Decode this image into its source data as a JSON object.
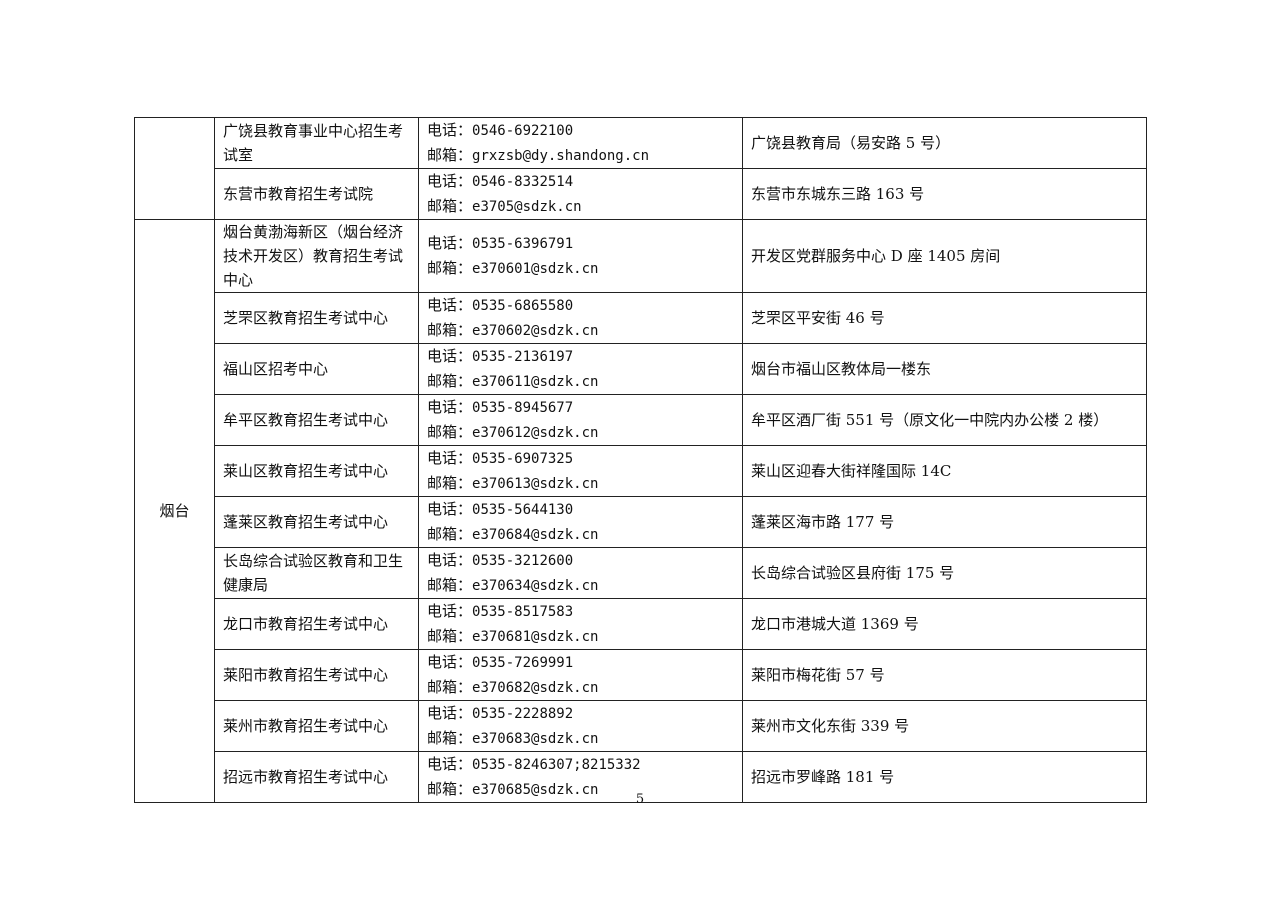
{
  "table": {
    "groups": [
      {
        "city": "",
        "rows": [
          {
            "org": "广饶县教育事业中心招生考试室",
            "phone_label": "电话：",
            "phone": "0546-6922100",
            "email_label": "邮箱：",
            "email": "grxzsb@dy.shandong.cn",
            "address": "广饶县教育局（易安路 5 号）"
          },
          {
            "org": "东营市教育招生考试院",
            "phone_label": "电话：",
            "phone": "0546-8332514",
            "email_label": "邮箱：",
            "email": "e3705@sdzk.cn",
            "address": "东营市东城东三路 163 号"
          }
        ]
      },
      {
        "city": "烟台",
        "rows": [
          {
            "org": "烟台黄渤海新区（烟台经济技术开发区）教育招生考试中心",
            "phone_label": "电话：",
            "phone": "0535-6396791",
            "email_label": "邮箱：",
            "email": "e370601@sdzk.cn",
            "address": "开发区党群服务中心 D 座 1405 房间"
          },
          {
            "org": "芝罘区教育招生考试中心",
            "phone_label": "电话：",
            "phone": "0535-6865580",
            "email_label": "邮箱：",
            "email": "e370602@sdzk.cn",
            "address": "芝罘区平安街 46 号"
          },
          {
            "org": "福山区招考中心",
            "phone_label": "电话：",
            "phone": "0535-2136197",
            "email_label": "邮箱：",
            "email": "e370611@sdzk.cn",
            "address": "烟台市福山区教体局一楼东"
          },
          {
            "org": "牟平区教育招生考试中心",
            "phone_label": "电话：",
            "phone": "0535-8945677",
            "email_label": "邮箱：",
            "email": "e370612@sdzk.cn",
            "address": "牟平区酒厂街 551 号（原文化一中院内办公楼 2 楼）"
          },
          {
            "org": "莱山区教育招生考试中心",
            "phone_label": "电话：",
            "phone": "0535-6907325",
            "email_label": "邮箱：",
            "email": "e370613@sdzk.cn",
            "address": "莱山区迎春大街祥隆国际 14C"
          },
          {
            "org": "蓬莱区教育招生考试中心",
            "phone_label": "电话：",
            "phone": "0535-5644130",
            "email_label": "邮箱：",
            "email": "e370684@sdzk.cn",
            "address": "蓬莱区海市路 177 号"
          },
          {
            "org": "长岛综合试验区教育和卫生健康局",
            "phone_label": "电话：",
            "phone": "0535-3212600",
            "email_label": "邮箱：",
            "email": "e370634@sdzk.cn",
            "address": "长岛综合试验区县府街 175 号"
          },
          {
            "org": "龙口市教育招生考试中心",
            "phone_label": "电话：",
            "phone": "0535-8517583",
            "email_label": "邮箱：",
            "email": "e370681@sdzk.cn",
            "address": "龙口市港城大道 1369 号"
          },
          {
            "org": "莱阳市教育招生考试中心",
            "phone_label": "电话：",
            "phone": "0535-7269991",
            "email_label": "邮箱：",
            "email": "e370682@sdzk.cn",
            "address": "莱阳市梅花街 57 号"
          },
          {
            "org": "莱州市教育招生考试中心",
            "phone_label": "电话：",
            "phone": "0535-2228892",
            "email_label": "邮箱：",
            "email": "e370683@sdzk.cn",
            "address": "莱州市文化东街 339 号"
          },
          {
            "org": "招远市教育招生考试中心",
            "phone_label": "电话：",
            "phone": "0535-8246307;8215332",
            "email_label": "邮箱：",
            "email": "e370685@sdzk.cn",
            "address": "招远市罗峰路 181 号"
          }
        ]
      }
    ]
  },
  "page_number": "5"
}
